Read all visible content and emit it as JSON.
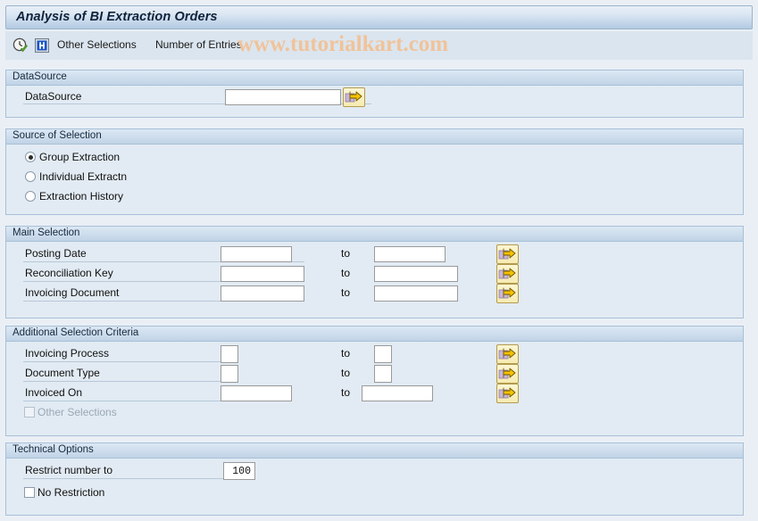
{
  "window": {
    "title": "Analysis of BI Extraction Orders"
  },
  "toolbar": {
    "execute_icon": "clock-check-icon",
    "info_icon": "info-icon",
    "other_selections_label": "Other Selections",
    "number_of_entries_label": "Number of Entries",
    "watermark": "www.tutorialkart.com",
    "watermark_color": "#f0c39a"
  },
  "sections": {
    "datasource": {
      "header": "DataSource",
      "row_label": "DataSource",
      "value": "",
      "arrow_icon": "multiple-selection-arrow-icon"
    },
    "source_of_selection": {
      "header": "Source of Selection",
      "options": [
        {
          "label": "Group Extraction",
          "selected": true
        },
        {
          "label": "Individual Extractn",
          "selected": false
        },
        {
          "label": "Extraction History",
          "selected": false
        }
      ]
    },
    "main_selection": {
      "header": "Main Selection",
      "to_label": "to",
      "rows": [
        {
          "label": "Posting Date",
          "from": "",
          "to": ""
        },
        {
          "label": "Reconciliation Key",
          "from": "",
          "to": ""
        },
        {
          "label": "Invoicing Document",
          "from": "",
          "to": ""
        }
      ]
    },
    "additional_selection_criteria": {
      "header": "Additional Selection Criteria",
      "to_label": "to",
      "rows": [
        {
          "label": "Invoicing Process",
          "from": "",
          "to": ""
        },
        {
          "label": "Document Type",
          "from": "",
          "to": ""
        },
        {
          "label": "Invoiced On",
          "from": "",
          "to": ""
        }
      ],
      "other_selections": {
        "label": "Other Selections",
        "checked": false,
        "disabled": true
      }
    },
    "technical_options": {
      "header": "Technical Options",
      "restrict_label": "Restrict number to",
      "restrict_value": "100",
      "no_restriction": {
        "label": "No Restriction",
        "checked": false
      }
    }
  },
  "colors": {
    "page_background": "#eaeff5",
    "panel_background": "#e2ebf3",
    "panel_border": "#a8c0d8",
    "title_text": "#10233b",
    "arrow_button": "#f6ebb2"
  }
}
